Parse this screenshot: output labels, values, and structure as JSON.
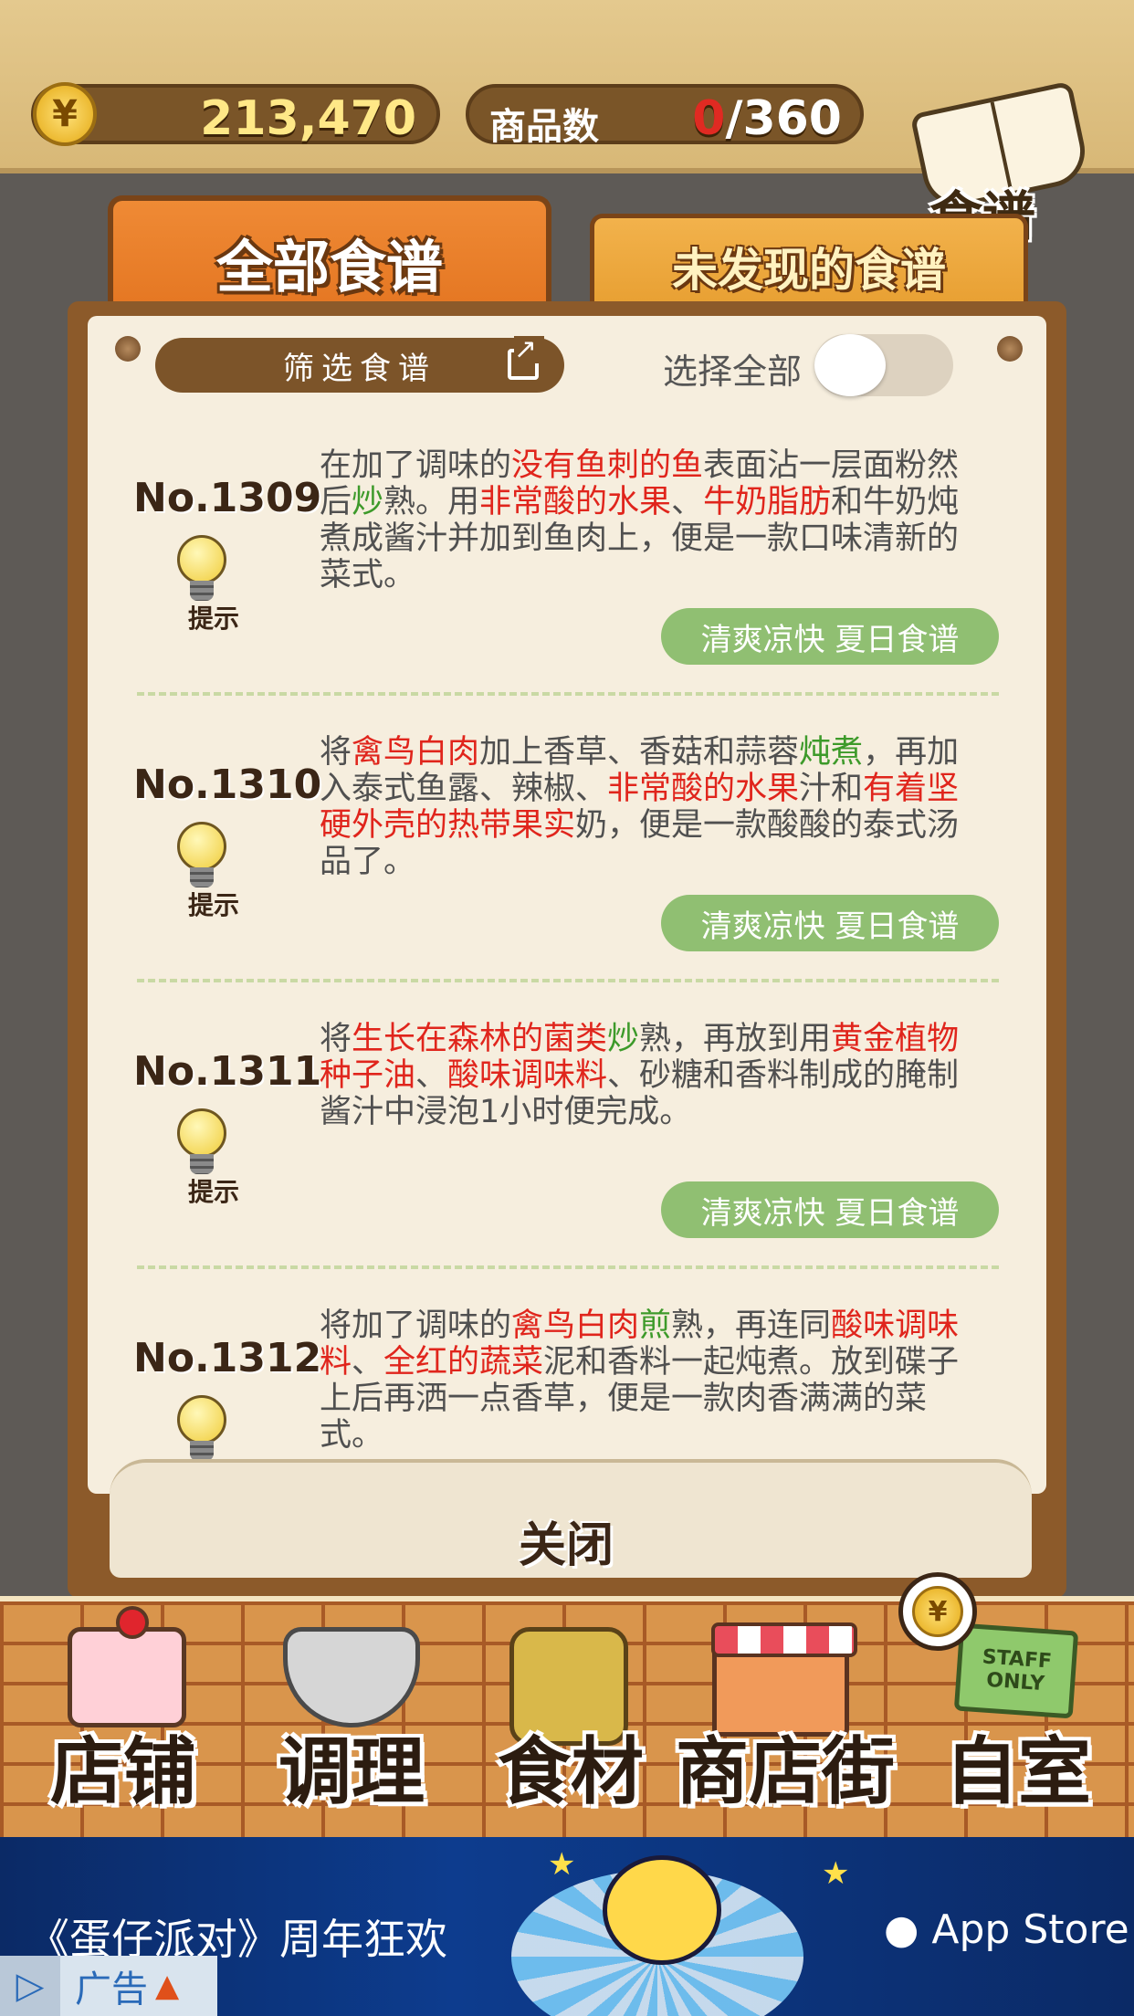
{
  "header": {
    "money": "213,470",
    "currency_icon": "yen-coin-icon",
    "goods_label": "商品数",
    "goods_current": "0",
    "goods_total": "/360",
    "recipe_book_label": "食谱"
  },
  "tabs": {
    "all": "全部食谱",
    "undiscovered": "未发现的食谱"
  },
  "filter": {
    "label": "筛选食谱",
    "select_all_label": "选择全部",
    "select_all_on": false
  },
  "recipes": [
    {
      "number": "No.1309",
      "hint": "提示",
      "tag": "清爽凉快 夏日食谱",
      "desc": [
        {
          "t": "在加了调味的",
          "c": ""
        },
        {
          "t": "没有鱼刺的鱼",
          "c": "r"
        },
        {
          "t": "表面沾一层面粉然后",
          "c": ""
        },
        {
          "t": "炒",
          "c": "g"
        },
        {
          "t": "熟。用",
          "c": ""
        },
        {
          "t": "非常酸的水果",
          "c": "r"
        },
        {
          "t": "、",
          "c": ""
        },
        {
          "t": "牛奶脂肪",
          "c": "r"
        },
        {
          "t": "和牛奶炖煮成酱汁并加到鱼肉上，便是一款口味清新的菜式。",
          "c": ""
        }
      ]
    },
    {
      "number": "No.1310",
      "hint": "提示",
      "tag": "清爽凉快 夏日食谱",
      "desc": [
        {
          "t": "将",
          "c": ""
        },
        {
          "t": "禽鸟白肉",
          "c": "r"
        },
        {
          "t": "加上香草、香菇和蒜蓉",
          "c": ""
        },
        {
          "t": "炖煮",
          "c": "g"
        },
        {
          "t": "，再加入泰式鱼露、辣椒、",
          "c": ""
        },
        {
          "t": "非常酸的水果",
          "c": "r"
        },
        {
          "t": "汁和",
          "c": ""
        },
        {
          "t": "有着坚硬外壳的热带果实",
          "c": "r"
        },
        {
          "t": "奶，便是一款酸酸的泰式汤品了。",
          "c": ""
        }
      ]
    },
    {
      "number": "No.1311",
      "hint": "提示",
      "tag": "清爽凉快 夏日食谱",
      "desc": [
        {
          "t": "将",
          "c": ""
        },
        {
          "t": "生长在森林的菌类",
          "c": "r"
        },
        {
          "t": "炒",
          "c": "g"
        },
        {
          "t": "熟，再放到用",
          "c": ""
        },
        {
          "t": "黄金植物种子油",
          "c": "r"
        },
        {
          "t": "、",
          "c": ""
        },
        {
          "t": "酸味调味料",
          "c": "r"
        },
        {
          "t": "、砂糖和香料制成的腌制酱汁中浸泡1小时便完成。",
          "c": ""
        }
      ]
    },
    {
      "number": "No.1312",
      "hint": "提示",
      "tag": "",
      "desc": [
        {
          "t": "将加了调味的",
          "c": ""
        },
        {
          "t": "禽鸟白肉",
          "c": "r"
        },
        {
          "t": "煎",
          "c": "g"
        },
        {
          "t": "熟，再连同",
          "c": ""
        },
        {
          "t": "酸味调味料",
          "c": "r"
        },
        {
          "t": "、",
          "c": ""
        },
        {
          "t": "全红的蔬菜",
          "c": "r"
        },
        {
          "t": "泥和香料一起炖煮。放到碟子上后再洒一点香草，便是一款肉香满满的菜式。",
          "c": ""
        }
      ]
    }
  ],
  "close_label": "关闭",
  "nav": [
    {
      "label": "店铺",
      "icon": "cake-icon"
    },
    {
      "label": "调理",
      "icon": "mixing-bowl-icon"
    },
    {
      "label": "食材",
      "icon": "ingredient-bag-icon"
    },
    {
      "label": "商店街",
      "icon": "shop-icon"
    },
    {
      "label": "自室",
      "icon": "staff-only-sign-icon"
    }
  ],
  "staff_sign_text": "STAFF ONLY",
  "ad": {
    "title": "《蛋仔派对》周年狂欢",
    "store": "App Store",
    "badge": "广告"
  },
  "colors": {
    "highlight_red": "#e0251c",
    "highlight_green": "#3d9a2a",
    "tag_green": "#90bf72",
    "tab_orange": "#e37420"
  }
}
